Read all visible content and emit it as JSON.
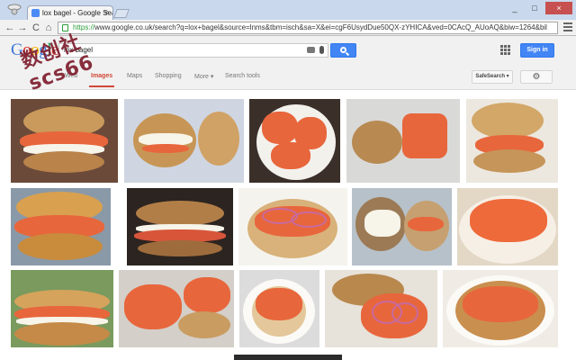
{
  "browser": {
    "tab_title": "lox bagel - Google Search",
    "tab_close": "×",
    "url_scheme": "https://",
    "url_rest": "www.google.co.uk/search?q=lox+bagel&source=lnms&tbm=isch&sa=X&ei=cgF6UsydDue50QX-zYHICA&ved=0CAcQ_AUoAQ&biw=1264&bil",
    "back": "←",
    "forward": "→",
    "reload": "C",
    "home": "⌂"
  },
  "google": {
    "logo_letters": [
      "G",
      "o",
      "o",
      "g",
      "l",
      "e"
    ],
    "search_value": "lox bagel",
    "signin_label": "Sign in",
    "tabs": [
      {
        "label": "Web",
        "active": false
      },
      {
        "label": "Images",
        "active": true
      },
      {
        "label": "Maps",
        "active": false
      },
      {
        "label": "Shopping",
        "active": false
      },
      {
        "label": "More ▾",
        "active": false
      },
      {
        "label": "Search tools",
        "active": false
      }
    ],
    "safesearch_label": "SafeSearch ▾",
    "gear_label": "⚙"
  },
  "watermark": {
    "text": "数创社scs66"
  },
  "colors": {
    "accent_red": "#d14836",
    "blue": "#4285f4",
    "salmon": "#e8663c"
  }
}
